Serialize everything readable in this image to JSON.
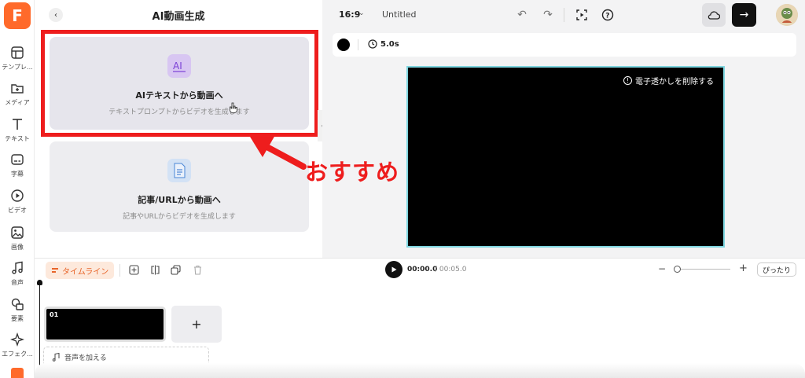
{
  "app": {
    "logo_letter": "F",
    "brand_color": "#ff6a2b"
  },
  "rail": {
    "items": [
      {
        "label": "テンプレ..."
      },
      {
        "label": "メディア"
      },
      {
        "label": "テキスト"
      },
      {
        "label": "字幕"
      },
      {
        "label": "ビデオ"
      },
      {
        "label": "画像"
      },
      {
        "label": "音声"
      },
      {
        "label": "要素"
      },
      {
        "label": "エフェク..."
      }
    ]
  },
  "panel": {
    "title": "AI動画生成",
    "cards": [
      {
        "title": "AIテキストから動画へ",
        "subtitle": "テキストプロンプトからビデオを生成します",
        "icon": "ai-text-icon"
      },
      {
        "title": "記事/URLから動画へ",
        "subtitle": "記事やURLからビデオを生成します",
        "icon": "document-icon"
      }
    ]
  },
  "annotation": {
    "text": "おすすめ",
    "color": "#ee1d1d"
  },
  "topbar": {
    "ratio": "16:9",
    "doc_title": "Untitled"
  },
  "propbar": {
    "duration": "5.0s"
  },
  "canvas": {
    "watermark_text": "電子透かしを削除する"
  },
  "timeline": {
    "tab_label": "タイムライン",
    "current_time": "00:00.0",
    "total_time": "/ 00:05.0",
    "fit_label": "ぴったり",
    "clip_number": "01",
    "add_clip": "+",
    "audio_add_label": "音声を加える"
  }
}
